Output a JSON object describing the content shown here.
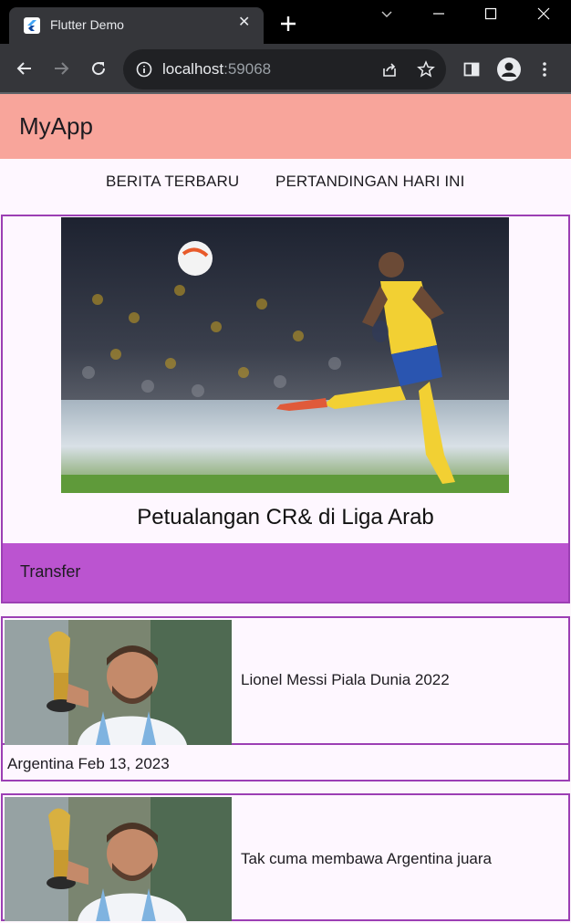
{
  "browser": {
    "tab_title": "Flutter Demo",
    "url_host": "localhost",
    "url_port": ":59068"
  },
  "app": {
    "title": "MyApp",
    "tabs": [
      {
        "label": "BERITA TERBARU"
      },
      {
        "label": "PERTANDINGAN HARI INI"
      }
    ],
    "featured": {
      "title": "Petualangan CR& di Liga Arab",
      "category": "Transfer"
    },
    "articles": [
      {
        "title": "Lionel Messi Piala Dunia 2022",
        "meta": "Argentina Feb 13, 2023"
      },
      {
        "title": "Tak cuma membawa Argentina juara",
        "meta": ""
      }
    ]
  },
  "colors": {
    "appbar": "#f8a59b",
    "border": "#9c3fb4",
    "category": "#bb54d0"
  }
}
